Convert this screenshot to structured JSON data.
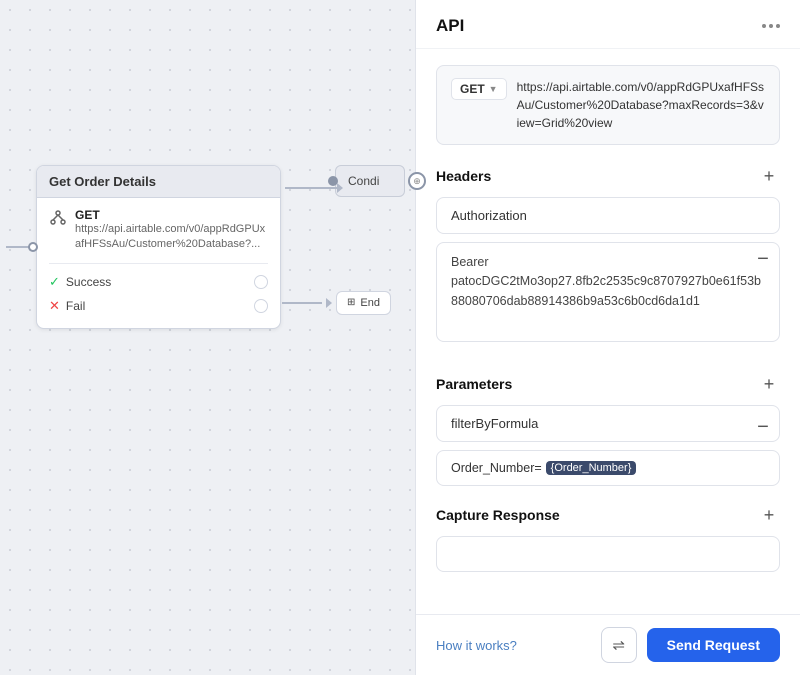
{
  "canvas": {
    "node": {
      "title": "Get Order Details",
      "method": "GET",
      "url": "https://api.airtable.com/v0/appRdGPUxafHFSsAu/Customer%20Database?...",
      "success_label": "Success",
      "fail_label": "Fail"
    },
    "cond_label": "Condi",
    "end_label": "End"
  },
  "panel": {
    "title": "API",
    "dots_icon": "···",
    "url_method": "GET",
    "url_value": "https://api.airtable.com/v0/appRdGPUxafHFSsAu/Customer%20Database?maxRecords=3&view=Grid%20view",
    "sections": {
      "headers": {
        "title": "Headers",
        "add_icon": "+",
        "remove_icon": "−",
        "key_placeholder": "Authorization",
        "key_value": "Authorization",
        "value_text": "Bearer patocDGC2tMo3op27.8fb2c2535c9c8707927b0e61f53b88080706dab88914386b9a53c6b0cd6da1d1"
      },
      "parameters": {
        "title": "Parameters",
        "add_icon": "+",
        "remove_icon": "−",
        "key_value": "filterByFormula",
        "formula_prefix": "Order_Number=",
        "formula_tag": "{Order_Number}"
      },
      "capture": {
        "title": "Capture Response",
        "add_icon": "+"
      }
    },
    "footer": {
      "how_it_works": "How it works?",
      "settings_icon": "⇌",
      "send_button": "Send Request"
    }
  }
}
